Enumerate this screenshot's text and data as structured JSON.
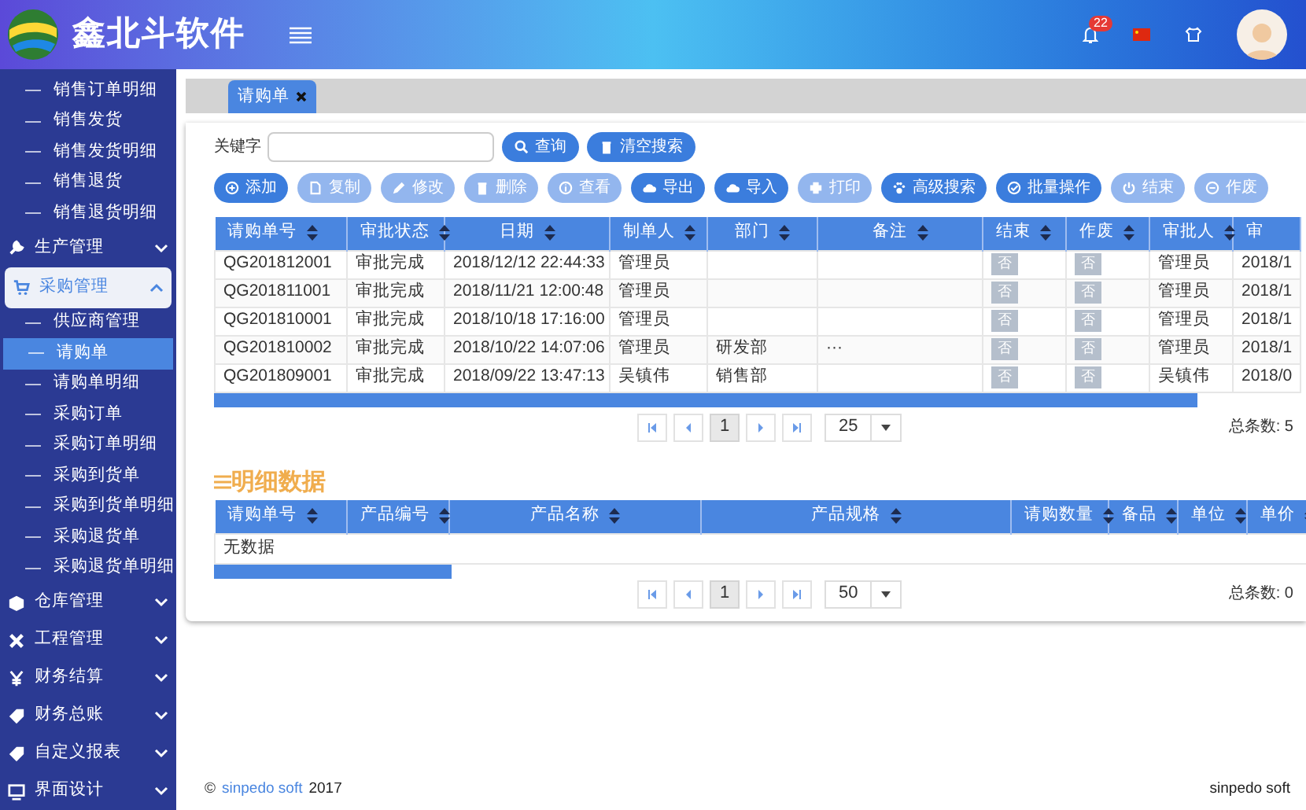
{
  "header": {
    "title": "鑫北斗软件",
    "notification_count": "22"
  },
  "sidebar": {
    "leading_children": [
      {
        "label": "销售订单明细",
        "selected": false
      },
      {
        "label": "销售发货",
        "selected": false
      },
      {
        "label": "销售发货明细",
        "selected": false
      },
      {
        "label": "销售退货",
        "selected": false
      },
      {
        "label": "销售退货明细",
        "selected": false
      }
    ],
    "groups": [
      {
        "label": "生产管理",
        "expanded": false
      },
      {
        "label": "采购管理",
        "expanded": true,
        "children": [
          {
            "label": "供应商管理",
            "selected": false
          },
          {
            "label": "请购单",
            "selected": true
          },
          {
            "label": "请购单明细",
            "selected": false
          },
          {
            "label": "采购订单",
            "selected": false
          },
          {
            "label": "采购订单明细",
            "selected": false
          },
          {
            "label": "采购到货单",
            "selected": false
          },
          {
            "label": "采购到货单明细",
            "selected": false
          },
          {
            "label": "采购退货单",
            "selected": false
          },
          {
            "label": "采购退货单明细",
            "selected": false
          }
        ]
      },
      {
        "label": "仓库管理",
        "expanded": false
      },
      {
        "label": "工程管理",
        "expanded": false
      },
      {
        "label": "财务结算",
        "expanded": false
      },
      {
        "label": "财务总账",
        "expanded": false
      },
      {
        "label": "自定义报表",
        "expanded": false
      },
      {
        "label": "界面设计",
        "expanded": false
      }
    ]
  },
  "tabs": [
    {
      "label": "请购单",
      "selected": true
    }
  ],
  "search": {
    "label": "关键字",
    "buttons": [
      {
        "label": "查询"
      },
      {
        "label": "清空搜索"
      }
    ]
  },
  "toolbar": [
    {
      "label": "添加",
      "disabled": false
    },
    {
      "label": "复制",
      "disabled": true
    },
    {
      "label": "修改",
      "disabled": true
    },
    {
      "label": "删除",
      "disabled": true
    },
    {
      "label": "查看",
      "disabled": true
    },
    {
      "label": "导出",
      "disabled": false
    },
    {
      "label": "导入",
      "disabled": false
    },
    {
      "label": "打印",
      "disabled": true
    },
    {
      "label": "高级搜索",
      "disabled": false
    },
    {
      "label": "批量操作",
      "disabled": false
    },
    {
      "label": "结束",
      "disabled": true
    },
    {
      "label": "作废",
      "disabled": true
    }
  ],
  "table": {
    "columns": [
      {
        "label": "请购单号",
        "sortable": true
      },
      {
        "label": "审批状态",
        "sortable": true
      },
      {
        "label": "日期",
        "sortable": true
      },
      {
        "label": "制单人",
        "sortable": true
      },
      {
        "label": "部门",
        "sortable": true
      },
      {
        "label": "备注",
        "sortable": true
      },
      {
        "label": "结束",
        "sortable": true
      },
      {
        "label": "作废",
        "sortable": true
      },
      {
        "label": "审批人",
        "sortable": true
      },
      {
        "label": "审",
        "sortable": false
      }
    ],
    "rows": [
      [
        "QG201812001",
        "审批完成",
        "2018/12/12 22:44:33",
        "管理员",
        "",
        "",
        "否",
        "否",
        "管理员",
        "2018/1"
      ],
      [
        "QG201811001",
        "审批完成",
        "2018/11/21 12:00:48",
        "管理员",
        "",
        "",
        "否",
        "否",
        "管理员",
        "2018/1"
      ],
      [
        "QG201810001",
        "审批完成",
        "2018/10/18 17:16:00",
        "管理员",
        "",
        "",
        "否",
        "否",
        "管理员",
        "2018/1"
      ],
      [
        "QG201810002",
        "审批完成",
        "2018/10/22 14:07:06",
        "管理员",
        "研发部",
        "···",
        "否",
        "否",
        "管理员",
        "2018/1"
      ],
      [
        "QG201809001",
        "审批完成",
        "2018/09/22 13:47:13",
        "吴镇伟",
        "销售部",
        "",
        "否",
        "否",
        "吴镇伟",
        "2018/0"
      ]
    ],
    "pagination": {
      "page": "1",
      "page_size": "25",
      "total": "总条数: 5"
    }
  },
  "detail": {
    "title": "明细数据",
    "columns": [
      {
        "label": "请购单号",
        "sortable": true
      },
      {
        "label": "产品编号",
        "sortable": true
      },
      {
        "label": "产品名称",
        "sortable": true
      },
      {
        "label": "产品规格",
        "sortable": true
      },
      {
        "label": "请购数量",
        "sortable": true
      },
      {
        "label": "备品",
        "sortable": true
      },
      {
        "label": "单位",
        "sortable": true
      },
      {
        "label": "单价",
        "sortable": true
      }
    ],
    "empty_text": "无数据",
    "pagination": {
      "page": "1",
      "page_size": "50",
      "total": "总条数: 0"
    }
  },
  "footer": {
    "copyright": "©",
    "link": "sinpedo soft",
    "year": "2017",
    "right": "sinpedo soft"
  }
}
